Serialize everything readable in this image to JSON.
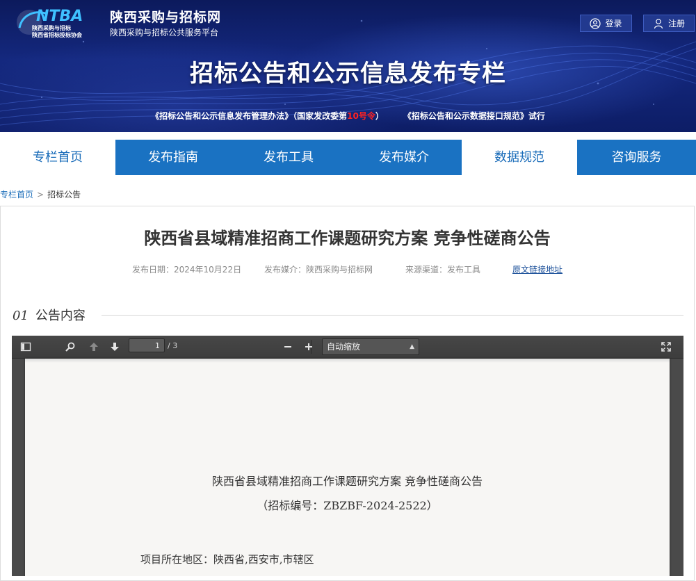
{
  "header": {
    "logo_text": "NTBA",
    "logo_sub1": "陕西采购与招标",
    "logo_sub2": "陕西省招标投标协会",
    "site_name": "陕西采购与招标网",
    "site_subtitle": "陕西采购与招标公共服务平台",
    "login_label": "登录",
    "register_label": "注册",
    "banner_title": "招标公告和公示信息发布专栏",
    "notice1_a": "《招标公告和公示信息发布管理办法》（国家发改委第",
    "notice1_red": "10号令",
    "notice1_b": "）",
    "notice2": "《招标公告和公示数据接口规范》试行"
  },
  "nav": {
    "items": [
      "专栏首页",
      "发布指南",
      "发布工具",
      "发布媒介",
      "数据规范",
      "咨询服务"
    ]
  },
  "breadcrumb": {
    "home": "专栏首页",
    "separator": ">",
    "current": "招标公告"
  },
  "article": {
    "title": "陕西省县域精准招商工作课题研究方案 竞争性磋商公告",
    "date": "发布日期：2024年10月22日",
    "media": "发布媒介：陕西采购与招标网",
    "channel": "来源渠道：发布工具",
    "source_link": "原文链接地址"
  },
  "section": {
    "number": "01",
    "label": "公告内容"
  },
  "pdf": {
    "page_current": "1",
    "page_total": "/ 3",
    "zoom": "自动缩放",
    "doc_title": "陕西省县域精准招商工作课题研究方案 竞争性磋商公告",
    "doc_number": "（招标编号：ZBZBF-2024-2522）",
    "doc_location": "项目所在地区：陕西省,西安市,市辖区"
  },
  "colors": {
    "nav_blue": "#1a72c2",
    "banner_dark": "#0c1a5c",
    "link_blue": "#1a6cb9",
    "highlight_red": "#ff2222"
  }
}
